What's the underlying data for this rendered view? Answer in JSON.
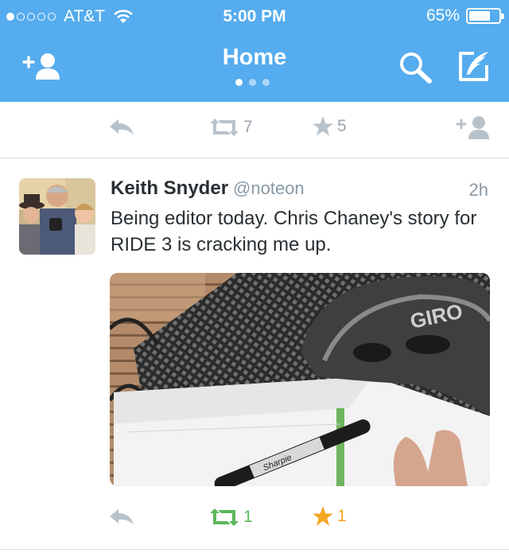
{
  "status_bar": {
    "carrier": "AT&T",
    "time": "5:00 PM",
    "battery": "65%",
    "battery_level": 0.65
  },
  "nav": {
    "title": "Home",
    "page_count": 3,
    "current_page": 1
  },
  "prev_tweet": {
    "retweets": "7",
    "favorites": "5"
  },
  "tweet": {
    "name": "Keith Snyder",
    "handle": "@noteon",
    "time": "2h",
    "text": "Being editor today. Chris Chaney's story for RIDE 3 is cracking me up.",
    "retweets": "1",
    "favorites": "1",
    "photo_caption": "GIRO",
    "pen_label": "Sharpie"
  },
  "colors": {
    "brand": "#55acee",
    "retweeted": "#5cb85c",
    "favorited": "#f5a623",
    "muted": "#9aa4ad"
  }
}
